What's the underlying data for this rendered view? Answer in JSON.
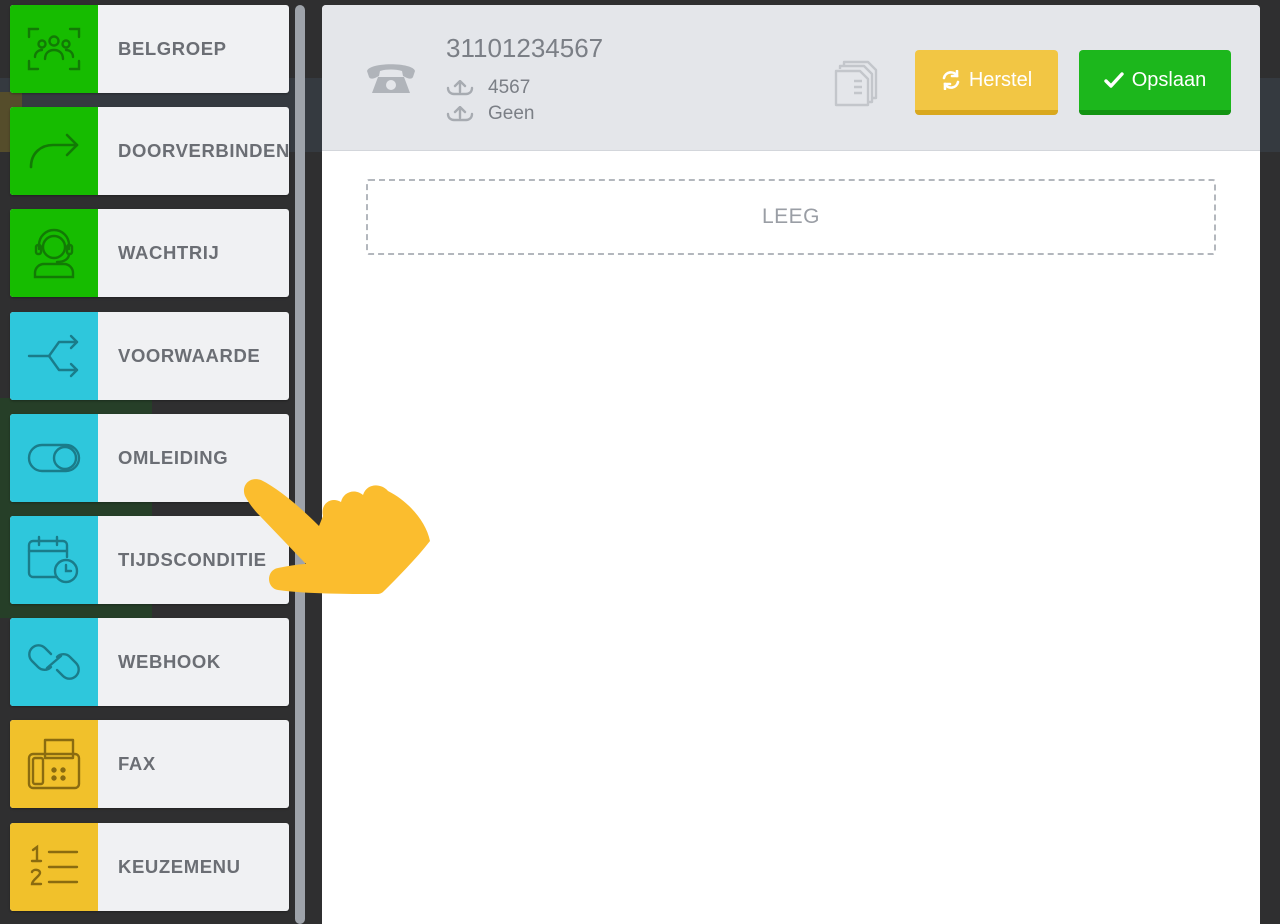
{
  "palette": {
    "items": [
      {
        "label": "BELGROEP",
        "icon": "group-focus-icon",
        "color": "#16bc00"
      },
      {
        "label": "DOORVERBINDEN",
        "icon": "forward-arrow-icon",
        "color": "#16bc00"
      },
      {
        "label": "WACHTRIJ",
        "icon": "headset-agent-icon",
        "color": "#16bc00"
      },
      {
        "label": "VOORWAARDE",
        "icon": "split-branch-icon",
        "color": "#2ec7dc"
      },
      {
        "label": "OMLEIDING",
        "icon": "toggle-icon",
        "color": "#2ec7dc"
      },
      {
        "label": "TIJDSCONDITIE",
        "icon": "calendar-clock-icon",
        "color": "#2ec7dc"
      },
      {
        "label": "WEBHOOK",
        "icon": "link-icon",
        "color": "#2ec7dc"
      },
      {
        "label": "FAX",
        "icon": "fax-icon",
        "color": "#f1c12b"
      },
      {
        "label": "KEUZEMENU",
        "icon": "numbered-list-icon",
        "color": "#f1c12b"
      }
    ]
  },
  "header": {
    "number": "31101234567",
    "extension": "4567",
    "fallback": "Geen",
    "herstel_label": "Herstel",
    "opslaan_label": "Opslaan"
  },
  "canvas": {
    "empty_label": "LEEG"
  },
  "colors": {
    "green": "#16bc00",
    "cyan": "#2ec7dc",
    "yellow": "#f1c12b",
    "save": "#1cb71c",
    "reset": "#f2c644"
  }
}
